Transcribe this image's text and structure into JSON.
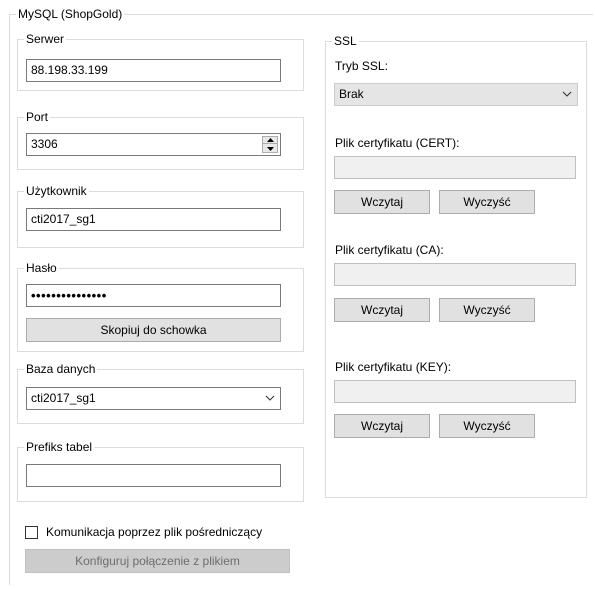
{
  "group_title": "MySQL (ShopGold)",
  "server": {
    "label": "Serwer",
    "value": "88.198.33.199"
  },
  "port": {
    "label": "Port",
    "value": "3306"
  },
  "user": {
    "label": "Użytkownik",
    "value": "cti2017_sg1"
  },
  "password": {
    "label": "Hasło",
    "value": "•••••••••••••••",
    "copy_button": "Skopiuj do schowka"
  },
  "database": {
    "label": "Baza danych",
    "value": "cti2017_sg1"
  },
  "prefix": {
    "label": "Prefiks tabel",
    "value": ""
  },
  "intermediate": {
    "checkbox_label": "Komunikacja poprzez plik pośredniczący",
    "checked": false,
    "configure_button": "Konfiguruj połączenie z plikiem"
  },
  "ssl": {
    "title": "SSL",
    "mode_label": "Tryb SSL:",
    "mode_value": "Brak",
    "cert": {
      "label": "Plik certyfikatu (CERT):",
      "value": "",
      "load": "Wczytaj",
      "clear": "Wyczyść"
    },
    "ca": {
      "label": "Plik certyfikatu (CA):",
      "value": "",
      "load": "Wczytaj",
      "clear": "Wyczyść"
    },
    "key": {
      "label": "Plik certyfikatu (KEY):",
      "value": "",
      "load": "Wczytaj",
      "clear": "Wyczyść"
    }
  },
  "icons": {
    "dropdown": "chevron-down-icon",
    "spinner_up": "triangle-up-icon",
    "spinner_down": "triangle-down-icon"
  }
}
